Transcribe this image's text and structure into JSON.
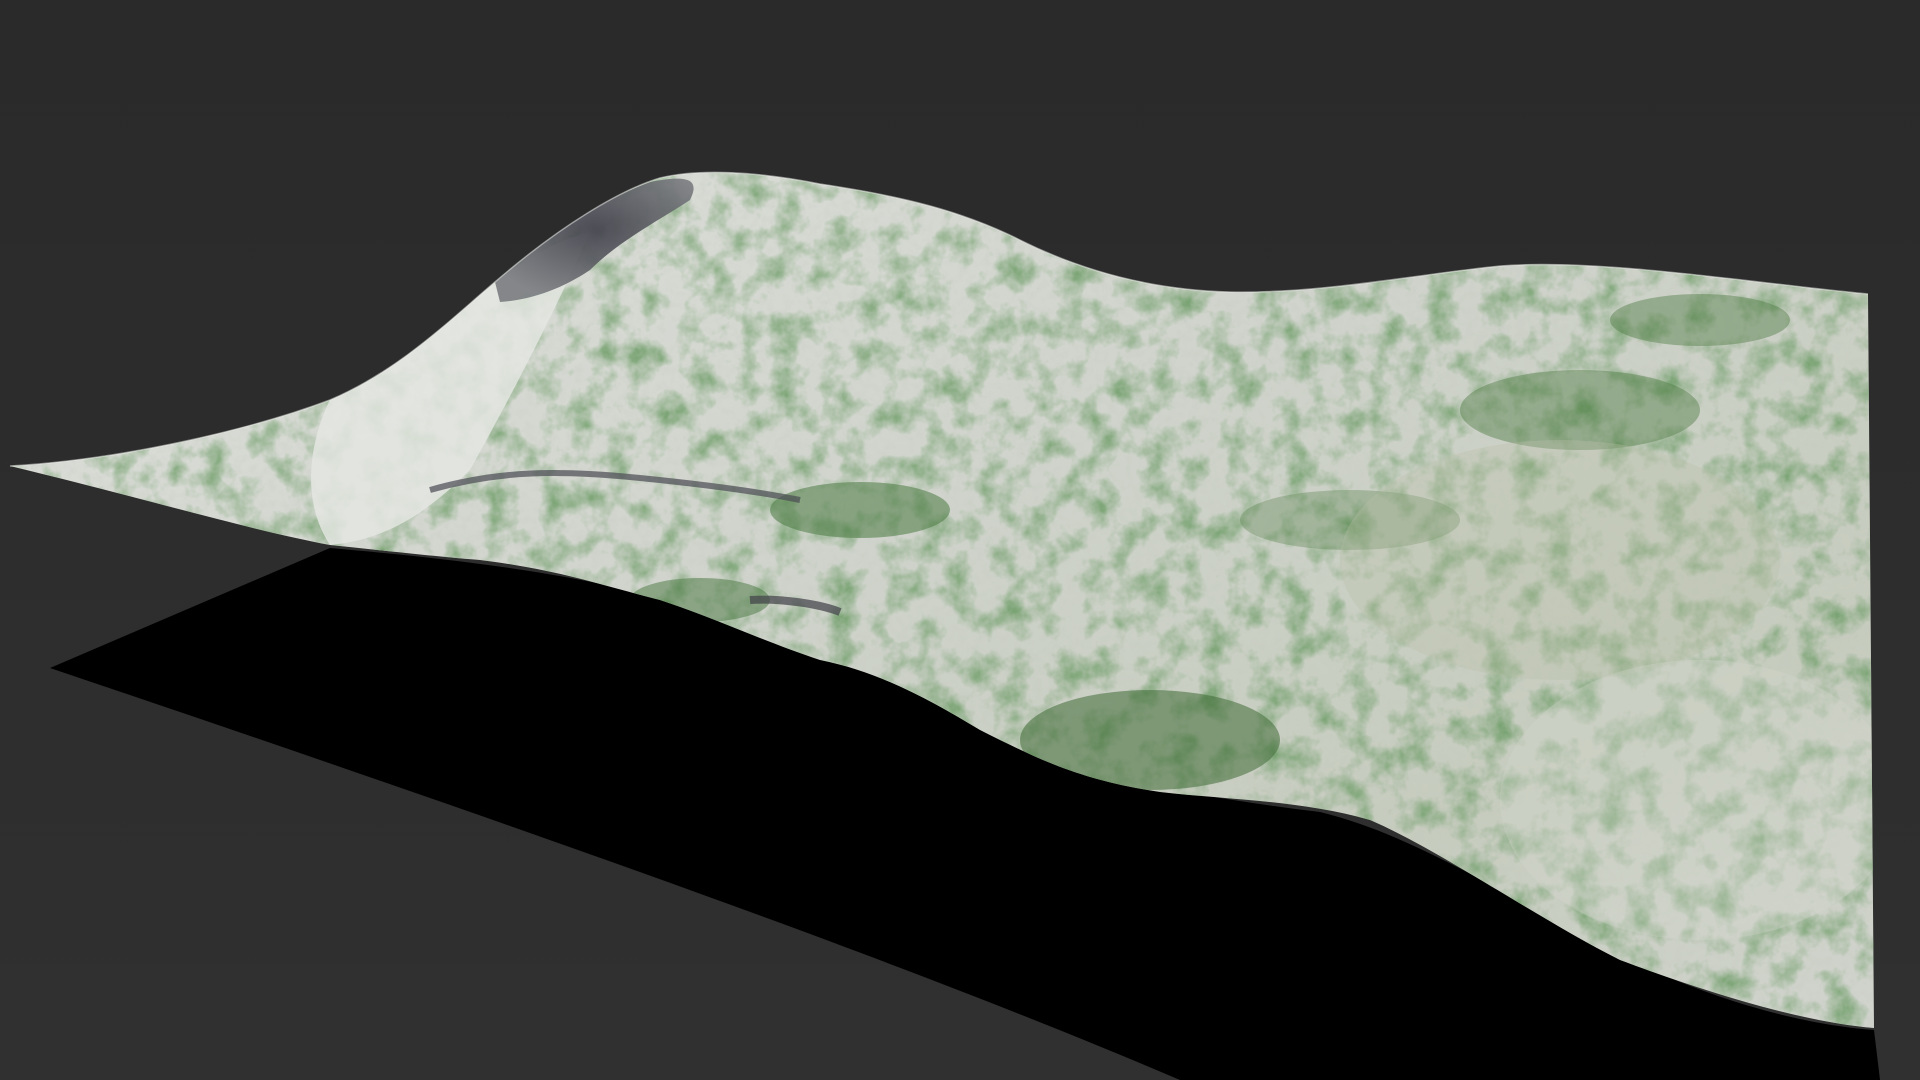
{
  "scene": {
    "subject": "terrain-mesh",
    "colors": {
      "background": "#2b2b2b",
      "shadow": "#000000",
      "rock_light": "#d9dbd6",
      "rock_mid": "#c7cbc4",
      "vegetation": "#5e8a4c",
      "vegetation_dark": "#3f6b37",
      "peak_rock": "#4a4a52"
    }
  }
}
